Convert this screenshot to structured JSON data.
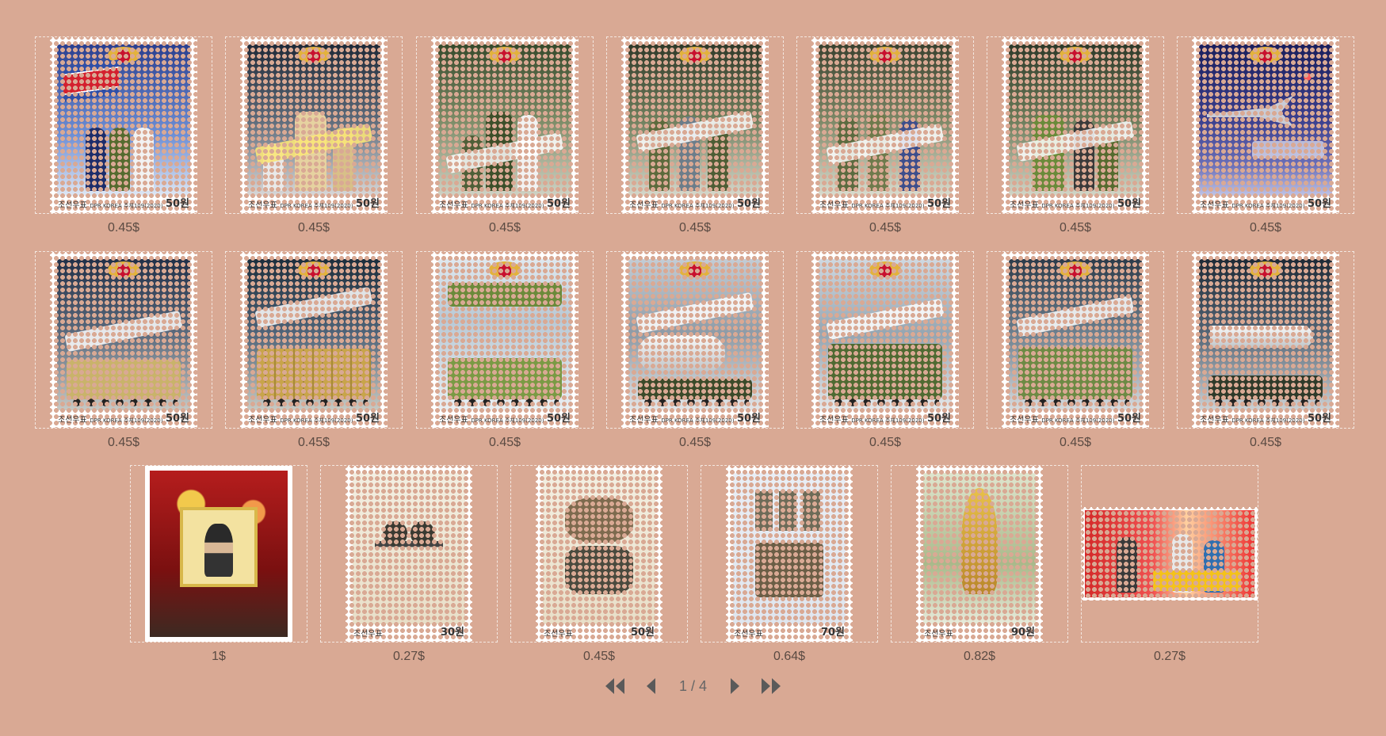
{
  "items": [
    {
      "price": "0.45$"
    },
    {
      "price": "0.45$"
    },
    {
      "price": "0.45$"
    },
    {
      "price": "0.45$"
    },
    {
      "price": "0.45$"
    },
    {
      "price": "0.45$"
    },
    {
      "price": "0.45$"
    },
    {
      "price": "0.45$"
    },
    {
      "price": "0.45$"
    },
    {
      "price": "0.45$"
    },
    {
      "price": "0.45$"
    },
    {
      "price": "0.45$"
    },
    {
      "price": "0.45$"
    },
    {
      "price": "0.45$"
    },
    {
      "price": "1$"
    },
    {
      "price": "0.27$"
    },
    {
      "price": "0.45$"
    },
    {
      "price": "0.64$"
    },
    {
      "price": "0.82$"
    },
    {
      "price": "0.27$"
    }
  ],
  "stamp_text": {
    "country": "조선우표",
    "issuer": "DPR KOREA 주체109(2020)",
    "value": "50원"
  },
  "relic_stamps": {
    "a": {
      "value": "30원"
    },
    "b": {
      "value": "50원"
    },
    "c": {
      "value": "70원"
    },
    "d": {
      "value": "90원"
    }
  },
  "pager": {
    "label": "1 / 4"
  }
}
